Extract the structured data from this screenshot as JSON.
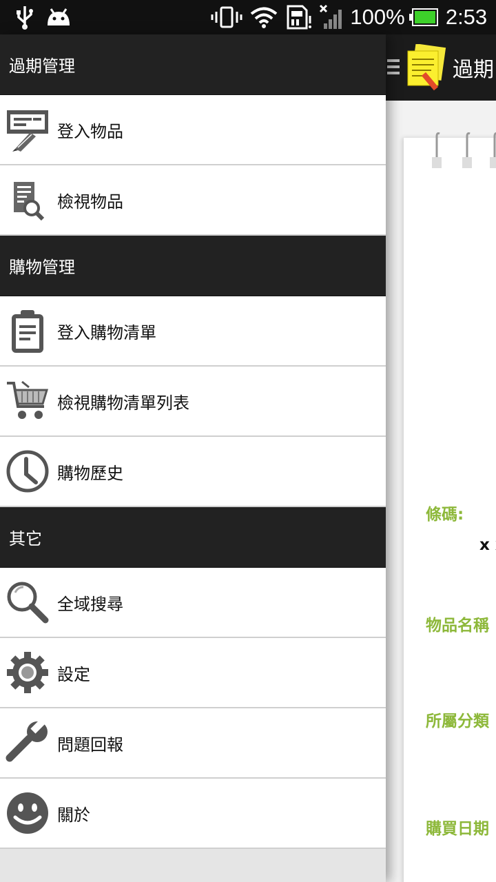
{
  "status_bar": {
    "battery": "100%",
    "time": "2:53",
    "icons": [
      "usb-icon",
      "android-debug-icon",
      "vibrate-icon",
      "wifi-icon",
      "sim-storage-icon",
      "no-signal-icon",
      "battery-icon"
    ]
  },
  "app": {
    "title": "過期",
    "fields": {
      "barcode_label": "條碼:",
      "barcode_value": "x x",
      "name_label": "物品名稱",
      "category_label": "所屬分類",
      "date_label": "購買日期"
    }
  },
  "drawer": {
    "sections": [
      {
        "title": "過期管理",
        "items": [
          {
            "label": "登入物品",
            "icon": "form-edit-icon"
          },
          {
            "label": "檢視物品",
            "icon": "document-search-icon"
          }
        ]
      },
      {
        "title": "購物管理",
        "items": [
          {
            "label": "登入購物清單",
            "icon": "clipboard-icon"
          },
          {
            "label": "檢視購物清單列表",
            "icon": "shopping-cart-icon"
          },
          {
            "label": "購物歷史",
            "icon": "clock-icon"
          }
        ]
      },
      {
        "title": "其它",
        "items": [
          {
            "label": "全域搜尋",
            "icon": "magnifier-icon"
          },
          {
            "label": "設定",
            "icon": "gear-icon"
          },
          {
            "label": "問題回報",
            "icon": "wrench-icon"
          },
          {
            "label": "關於",
            "icon": "smiley-icon"
          }
        ]
      }
    ]
  },
  "colors": {
    "section_bg": "#222222",
    "field_label": "#8db83a",
    "icon_gray": "#555555"
  }
}
